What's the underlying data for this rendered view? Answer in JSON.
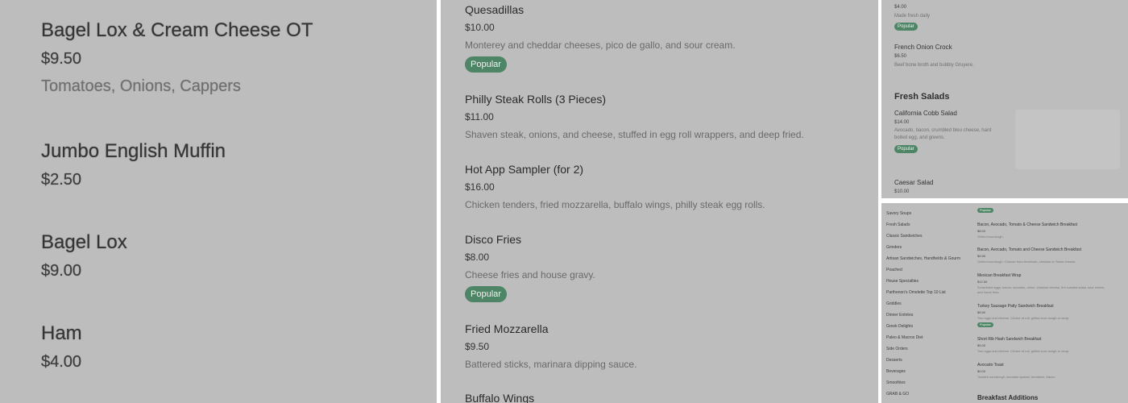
{
  "colors": {
    "panel_bg": "#bdbdbd",
    "badge_bg": "#4d8566",
    "badge_text": "#eef5ef",
    "divider": "#ffffff"
  },
  "panel1": {
    "items": [
      {
        "name": "Bagel Lox & Cream Cheese OT",
        "price": "$9.50",
        "desc": "Tomatoes, Onions, Cappers"
      },
      {
        "name": "Jumbo English Muffin",
        "price": "$2.50"
      },
      {
        "name": "Bagel Lox",
        "price": "$9.00"
      },
      {
        "name": "Ham",
        "price": "$4.00"
      }
    ]
  },
  "panel2": {
    "items": [
      {
        "name": "Quesadillas",
        "price": "$10.00",
        "desc": "Monterey and cheddar cheeses, pico de gallo, and sour cream.",
        "badge": "Popular"
      },
      {
        "name": "Philly Steak Rolls (3 Pieces)",
        "price": "$11.00",
        "desc": "Shaven steak, onions, and cheese, stuffed in egg roll wrappers, and deep fried."
      },
      {
        "name": "Hot App Sampler (for 2)",
        "price": "$16.00",
        "desc": "Chicken tenders, fried mozzarella, buffalo wings, philly steak egg rolls."
      },
      {
        "name": "Disco Fries",
        "price": "$8.00",
        "desc": "Cheese fries and house gravy.",
        "badge": "Popular"
      },
      {
        "name": "Fried Mozzarella",
        "price": "$9.50",
        "desc": "Battered sticks, marinara dipping sauce."
      },
      {
        "name": "Buffalo Wings"
      }
    ]
  },
  "panel3": {
    "top_item": {
      "price": "$4.00",
      "desc": "Made fresh daily",
      "badge": "Popular"
    },
    "french_onion": {
      "name": "French Onion Crock",
      "price": "$6.50",
      "desc": "Beef bone broth and bubbly Gruyere."
    },
    "section_title": "Fresh Salads",
    "cobb": {
      "name": "California Cobb Salad",
      "price": "$14.00",
      "desc_line1": "Avocado, bacon, crumbled bleu cheese, hard",
      "desc_line2": "boiled egg, and greens.",
      "badge": "Popular"
    },
    "caesar": {
      "name": "Caesar Salad",
      "price": "$10.00"
    }
  },
  "panel4": {
    "categories": [
      "Savory Soups",
      "Fresh Salads",
      "Classic Sandwiches",
      "Grinders",
      "Artisan Sandwiches, Handhelds & Gourm",
      "Poached",
      "House Specialties",
      "Parthenon's Omelette Top 10 List",
      "Griddles",
      "Dinner Entrées",
      "Greek Delights",
      "Paleo & Macros Diet",
      "Side Orders",
      "Desserts",
      "Beverages",
      "Smoothies",
      "GRAB & GO"
    ],
    "top_badge": "Popular",
    "items": [
      {
        "name": "Bacon, Avocado, Tomato & Cheese Sandwich Breakfast",
        "price": "$8.00",
        "desc": "Grilled sourdough."
      },
      {
        "name": "Bacon, Avocado, Tomato and Cheese Sandwich Breakfast",
        "price": "$9.50",
        "desc": "Grilled sourdough. Choose from American, cheddar or Swiss cheese."
      },
      {
        "name": "Mexican Breakfast Wrap",
        "price": "$12.50",
        "desc": "Scrambled eggs, bacon, avocado, onion, cheddar cheese, fire roasted salsa, sour cream,",
        "desc2": "and home fries."
      },
      {
        "name": "Turkey Sausage Patty Sandwich Breakfast",
        "price": "$5.50",
        "desc": "Two eggs and cheese. Choice of roll, grilled sour dough or wrap.",
        "badge": "Popular"
      },
      {
        "name": "Short Rib Hash Sandwich Breakfast",
        "price": "$9.00",
        "desc": "Two eggs and cheese. Choice of roll, grilled sour dough or wrap."
      },
      {
        "name": "Avocado Toast",
        "price": "$0.00",
        "desc": "Toasted sourdough, avocado spread, tomatoes, bacon."
      }
    ],
    "bottom_section": "Breakfast Additions"
  }
}
